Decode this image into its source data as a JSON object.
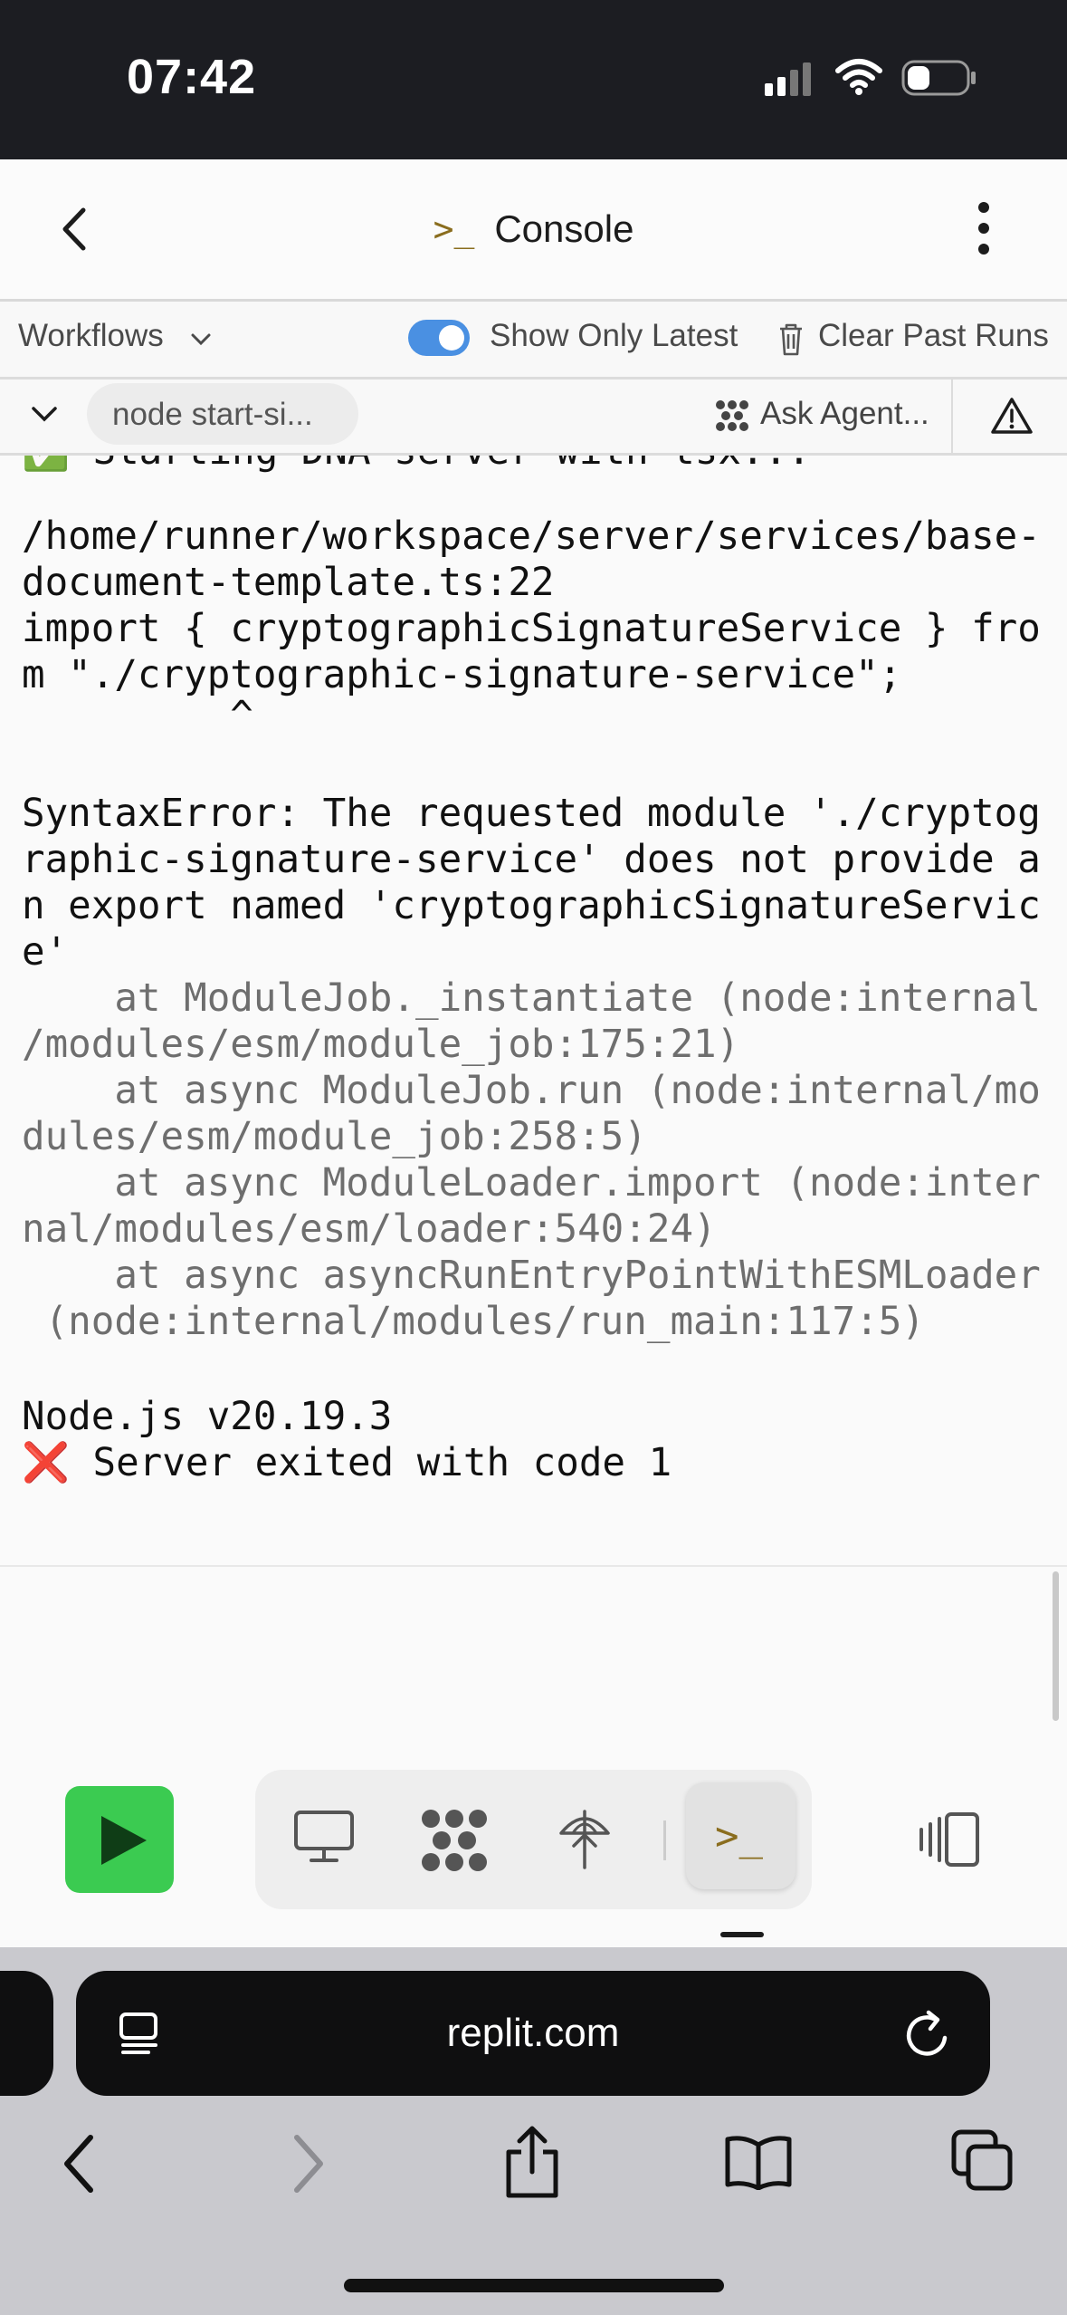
{
  "status_bar": {
    "time": "07:42"
  },
  "header": {
    "title_icon": ">_",
    "title": "Console"
  },
  "toolbar": {
    "workflows_label": "Workflows",
    "show_only_latest_label": "Show Only Latest",
    "show_only_latest_on": true,
    "clear_past_runs_label": "Clear Past Runs"
  },
  "filter_row": {
    "process_pill": "node start-si...",
    "ask_agent_label": "Ask Agent..."
  },
  "console": {
    "partial_line": "✅ Starting DNA server with tsx...",
    "lines": [
      "/home/runner/workspace/server/services/base-",
      "document-template.ts:22",
      "import { cryptographicSignatureService } fro",
      "m \"./cryptographic-signature-service\";",
      "         ^",
      "",
      "SyntaxError: The requested module './cryptog",
      "raphic-signature-service' does not provide a",
      "n export named 'cryptographicSignatureServic",
      "e'"
    ],
    "stack_lines": [
      "    at ModuleJob._instantiate (node:internal",
      "/modules/esm/module_job:175:21)",
      "    at async ModuleJob.run (node:internal/mo",
      "dules/esm/module_job:258:5)",
      "    at async ModuleLoader.import (node:inter",
      "nal/modules/esm/loader:540:24)",
      "    at async asyncRunEntryPointWithESMLoader",
      " (node:internal/modules/run_main:117:5)"
    ],
    "node_version": "Node.js v20.19.3",
    "exit_message": "❌ Server exited with code 1"
  },
  "dock": {
    "icons": [
      "monitor-icon",
      "agent-icon",
      "deploy-icon",
      "console-icon"
    ],
    "active": "console-icon",
    "console_glyph": ">_"
  },
  "browser": {
    "url": "replit.com",
    "nav_icons": [
      "back-icon",
      "forward-icon",
      "share-icon",
      "bookmarks-icon",
      "tabs-icon"
    ]
  },
  "colors": {
    "accent_blue": "#4a90e2",
    "run_green": "#3bcb51",
    "console_icon": "#8a6d1e"
  }
}
